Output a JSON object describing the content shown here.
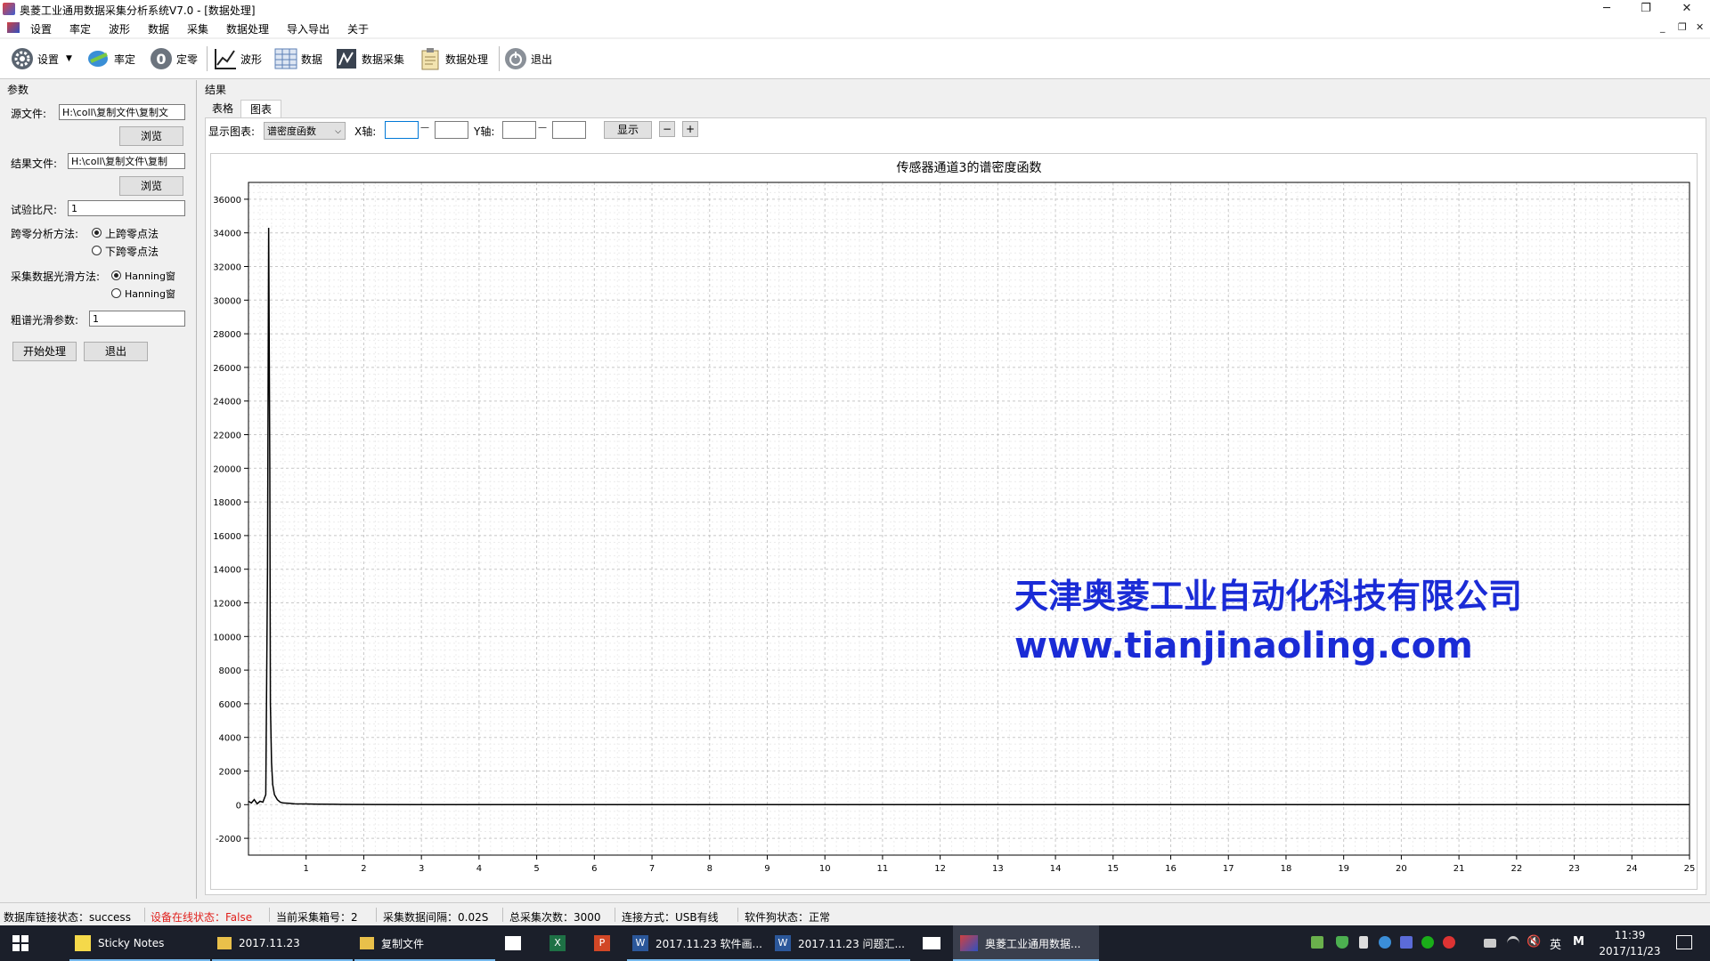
{
  "window": {
    "title": "奥菱工业通用数据采集分析系统V7.0 - [数据处理]",
    "min": "─",
    "max": "❐",
    "close": "✕"
  },
  "menu": [
    "设置",
    "率定",
    "波形",
    "数据",
    "采集",
    "数据处理",
    "导入导出",
    "关于"
  ],
  "toolbar": {
    "settings": "设置",
    "calibrate": "率定",
    "zero": "定零",
    "waveform": "波形",
    "data": "数据",
    "acquisition": "数据采集",
    "processing": "数据处理",
    "exit": "退出"
  },
  "params": {
    "group": "参数",
    "source_label": "源文件:",
    "source_value": "H:\\coll\\复制文件\\复制文",
    "browse1": "浏览",
    "result_label": "结果文件:",
    "result_value": "H:\\coll\\复制文件\\复制",
    "browse2": "浏览",
    "scale_label": "试验比尺:",
    "scale_value": "1",
    "zero_method_label": "跨零分析方法:",
    "zero_opt1": "上跨零点法",
    "zero_opt2": "下跨零点法",
    "smooth_label": "采集数据光滑方法:",
    "smooth_opt1": "Hanning窗",
    "smooth_opt2": "Hanning窗",
    "spectrum_label": "粗谱光滑参数:",
    "spectrum_value": "1",
    "start_btn": "开始处理",
    "exit_btn": "退出"
  },
  "results": {
    "group": "结果",
    "tab_table": "表格",
    "tab_chart": "图表",
    "display_label": "显示图表:",
    "display_value": "谱密度函数",
    "xaxis_label": "X轴:",
    "yaxis_label": "Y轴:",
    "dash": "—",
    "show_btn": "显示",
    "minus_btn": "−",
    "plus_btn": "+"
  },
  "chart_data": {
    "type": "line",
    "title": "传感器通道3的谱密度函数",
    "xlabel": "",
    "ylabel": "",
    "xlim": [
      0,
      25
    ],
    "ylim": [
      -3000,
      37000
    ],
    "xticks": [
      1,
      2,
      3,
      4,
      5,
      6,
      7,
      8,
      9,
      10,
      11,
      12,
      13,
      14,
      15,
      16,
      17,
      18,
      19,
      20,
      21,
      22,
      23,
      24,
      25
    ],
    "yticks": [
      -2000,
      0,
      2000,
      4000,
      6000,
      8000,
      10000,
      12000,
      14000,
      16000,
      18000,
      20000,
      22000,
      24000,
      26000,
      28000,
      30000,
      32000,
      34000,
      36000
    ],
    "grid": true,
    "series": [
      {
        "color": "#000000",
        "x": [
          0,
          0.05,
          0.1,
          0.15,
          0.2,
          0.25,
          0.3,
          0.33,
          0.35,
          0.37,
          0.38,
          0.4,
          0.42,
          0.45,
          0.5,
          0.55,
          0.6,
          0.7,
          0.8,
          1.0,
          1.2,
          1.5,
          2,
          3,
          5,
          10,
          15,
          20,
          25
        ],
        "y": [
          200,
          100,
          300,
          50,
          200,
          150,
          600,
          14000,
          34300,
          20000,
          6000,
          2500,
          1200,
          600,
          300,
          150,
          100,
          80,
          50,
          40,
          30,
          20,
          10,
          5,
          5,
          5,
          5,
          5,
          5
        ]
      }
    ]
  },
  "watermark": {
    "company": "天津奥菱工业自动化科技有限公司",
    "url": "www.tianjinaoling.com"
  },
  "status": {
    "db": "数据库链接状态：success",
    "device": "设备在线状态：False",
    "box": "当前采集箱号：2",
    "interval": "采集数据间隔：0.02S",
    "total": "总采集次数：3000",
    "conn": "连接方式：USB有线",
    "dog": "软件狗状态：正常"
  },
  "taskbar": {
    "items": [
      "Sticky Notes",
      "2017.11.23",
      "复制文件",
      "2017.11.23 软件画...",
      "2017.11.23 问题汇...",
      "奥菱工业通用数据..."
    ],
    "ime": "英",
    "time": "11:39",
    "date": "2017/11/23"
  },
  "colors": {
    "status_warn": "#e0201c",
    "watermark": "#1a2bd6",
    "accent": "#0078d7"
  }
}
